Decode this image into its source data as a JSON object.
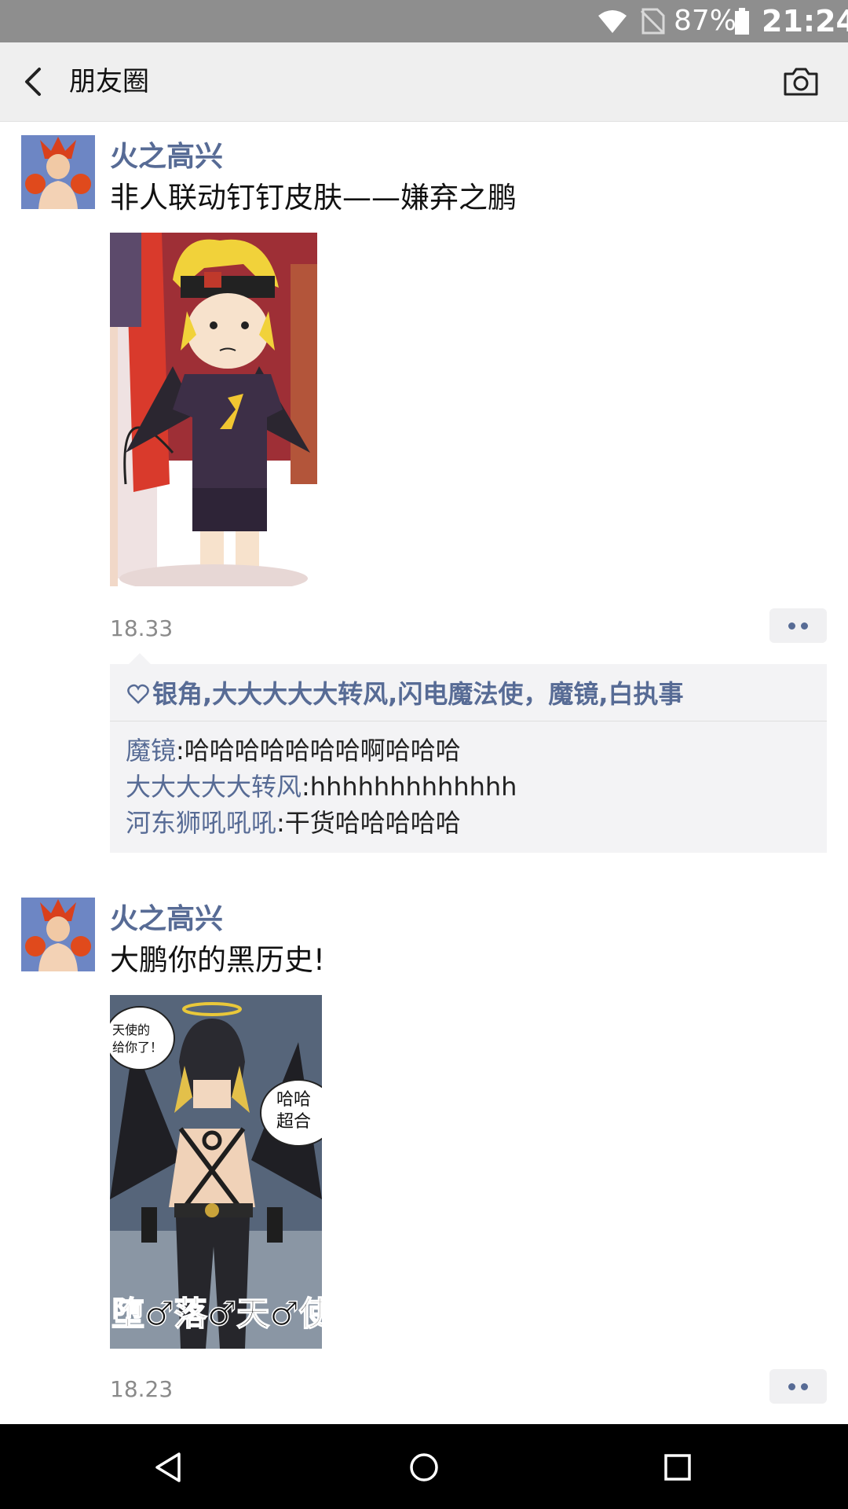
{
  "status_bar": {
    "battery_percent": "87%",
    "time": "21:24",
    "icons": [
      "wifi-icon",
      "no-sim-icon",
      "battery-icon"
    ]
  },
  "header": {
    "title": "朋友圈",
    "back_icon": "back-arrow-icon",
    "camera_icon": "camera-icon"
  },
  "posts": [
    {
      "author": "火之高兴",
      "text": "非人联动钉钉皮肤——嫌弃之鹏",
      "time": "18.33",
      "likes": "银角,大大大大大转风,闪电魔法使，魔镜,白执事",
      "comments": [
        {
          "name": "魔镜",
          "sep": ":",
          "text": "哈哈哈哈哈哈哈啊哈哈哈"
        },
        {
          "name": "大大大大大转风",
          "sep": ":",
          "text": "hhhhhhhhhhhhh"
        },
        {
          "name": "河东狮吼吼吼",
          "sep": ":",
          "text": "干货哈哈哈哈哈"
        }
      ]
    },
    {
      "author": "火之高兴",
      "text": "大鹏你的黑历史!",
      "time": "18.23",
      "image_text": {
        "bubble_left_line1": "天使的",
        "bubble_left_line2": "给你了！",
        "bubble_right_line1": "哈哈",
        "bubble_right_line2": "超合",
        "bottom": "堕♂落♂天♂使"
      }
    }
  ],
  "nav_bar": {
    "back": "nav-back-icon",
    "home": "nav-home-icon",
    "recents": "nav-recents-icon"
  },
  "colors": {
    "name_blue": "#576b95",
    "status_bar": "#8e8e8e",
    "header_bg": "#efefef",
    "comment_bg": "#f3f3f5",
    "nav_bar": "#000000"
  }
}
